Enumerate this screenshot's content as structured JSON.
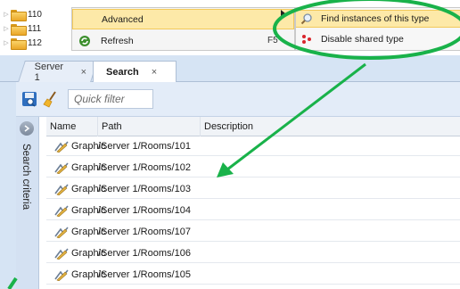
{
  "tree": {
    "items": [
      {
        "label": "110"
      },
      {
        "label": "111"
      },
      {
        "label": "112"
      }
    ]
  },
  "context_menu": {
    "items": [
      {
        "label": "Advanced",
        "shortcut": ""
      },
      {
        "label": "Refresh",
        "shortcut": "F5"
      }
    ],
    "submenu": [
      {
        "label": "Find instances of this type"
      },
      {
        "label": "Disable shared type"
      }
    ]
  },
  "tabs": [
    {
      "label": "Server 1",
      "close": "×"
    },
    {
      "label": "Search",
      "close": "×"
    }
  ],
  "search": {
    "quick_filter_placeholder": "Quick filter",
    "criteria_label": "Search criteria"
  },
  "grid": {
    "columns": [
      "Name",
      "Path",
      "Description"
    ],
    "rows": [
      {
        "name": "Graphic",
        "path": "/Server 1/Rooms/101"
      },
      {
        "name": "Graphic",
        "path": "/Server 1/Rooms/102"
      },
      {
        "name": "Graphic",
        "path": "/Server 1/Rooms/103"
      },
      {
        "name": "Graphic",
        "path": "/Server 1/Rooms/104"
      },
      {
        "name": "Graphic",
        "path": "/Server 1/Rooms/107"
      },
      {
        "name": "Graphic",
        "path": "/Server 1/Rooms/106"
      },
      {
        "name": "Graphic",
        "path": "/Server 1/Rooms/105"
      }
    ]
  },
  "colors": {
    "annotation": "#19b24a",
    "highlight": "#fde9a8",
    "tab_strip": "#d6e4f4"
  }
}
